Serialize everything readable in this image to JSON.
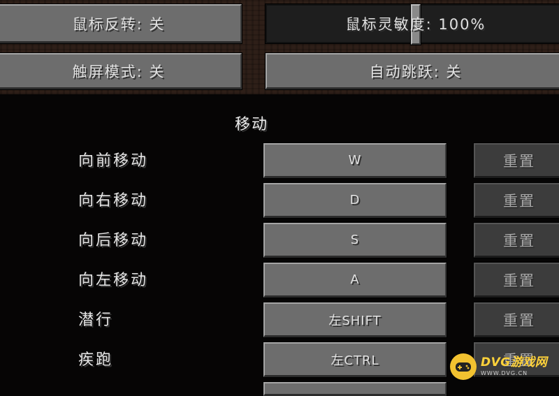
{
  "top_options": {
    "mouse_invert": "鼠标反转: 关",
    "mouse_sensitivity": "鼠标灵敏度: 100%",
    "touchscreen_mode": "触屏模式: 关",
    "auto_jump": "自动跳跃: 关"
  },
  "mouse_sensitivity_level": 1.0,
  "section": {
    "title": "移动"
  },
  "controls": [
    {
      "label": "向前移动",
      "key": "W",
      "reset": "重置"
    },
    {
      "label": "向右移动",
      "key": "D",
      "reset": "重置"
    },
    {
      "label": "向后移动",
      "key": "S",
      "reset": "重置"
    },
    {
      "label": "向左移动",
      "key": "A",
      "reset": "重置"
    },
    {
      "label": "潜行",
      "key": "左SHIFT",
      "reset": "重置"
    },
    {
      "label": "疾跑",
      "key": "左CTRL",
      "reset": "重置"
    }
  ],
  "watermark": {
    "name": "DVG游戏网",
    "site": "WWW.DVG.CN",
    "color": "#ffd23a"
  }
}
